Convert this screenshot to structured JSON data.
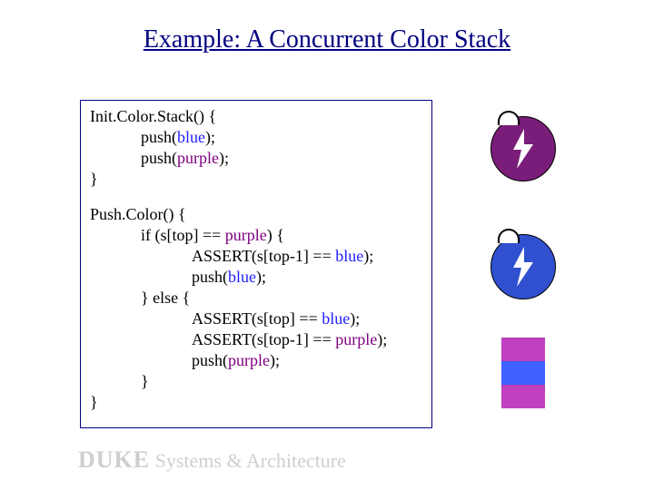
{
  "title": "Example: A Concurrent Color Stack",
  "code": {
    "init_sig": "Init.Color.Stack() {",
    "push_pre": "push(",
    "push_post": ");",
    "close": "}",
    "pushc_sig": "Push.Color() {",
    "if_pre": "if (s[top] == ",
    "if_post": ") {",
    "assert_pre": "ASSERT(s[top-1] == ",
    "assert_post": ");",
    "else_open": "} else {",
    "assert_top_pre": "ASSERT(s[top] == ",
    "assert_top_post": ");",
    "blue": "blue",
    "purple": "purple"
  },
  "footer": {
    "duke": "DUKE",
    "rest": " Systems & Architecture"
  },
  "colors": {
    "blue": "#4060ff",
    "purple": "#c040c0",
    "navy": "#000080",
    "thread_purple": "#7a1d7a",
    "thread_blue": "#3050d0"
  },
  "chart_data": {
    "type": "table",
    "description": "Pseudocode for two procedures on a concurrent color stack with two thread icons and a 3-cell stack visual.",
    "stack_cells": [
      "purple",
      "blue",
      "purple"
    ]
  }
}
